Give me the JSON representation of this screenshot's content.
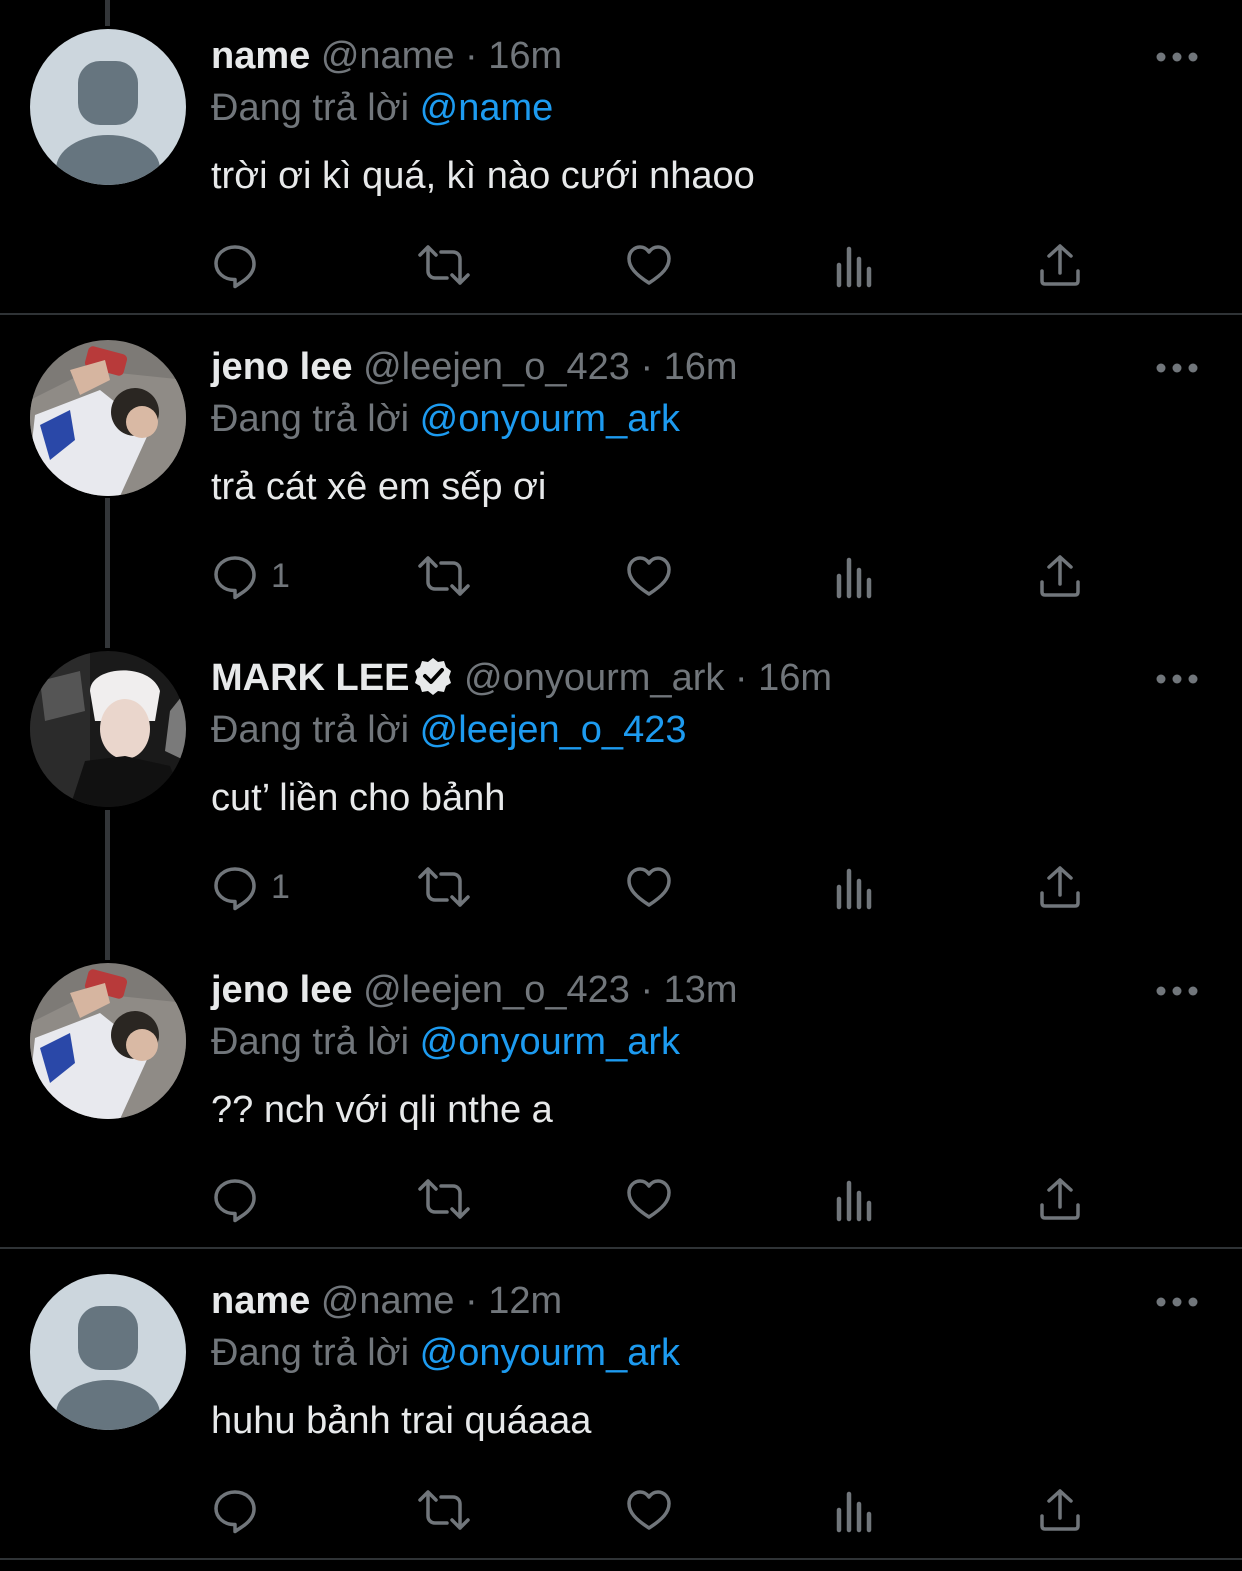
{
  "reply_prefix": "Đang trả lời",
  "tweets": [
    {
      "name": "name",
      "handle": "@name",
      "time": "16m",
      "replying_to": "@name",
      "text": "trời ơi kì quá, kì nào cưới nhaoo",
      "reply_count": "",
      "avatar": "default-avatar",
      "verified": false
    },
    {
      "name": "jeno lee",
      "handle": "@leejen_o_423",
      "time": "16m",
      "replying_to": "@onyourm_ark",
      "text": "trả cát xê em sếp ơi",
      "reply_count": "1",
      "avatar": "photo-avatar",
      "verified": false
    },
    {
      "name": "MARK LEE",
      "handle": "@onyourm_ark",
      "time": "16m",
      "replying_to": "@leejen_o_423",
      "text": "cut’ liền cho bảnh",
      "reply_count": "1",
      "avatar": "photo-avatar",
      "verified": true
    },
    {
      "name": "jeno lee",
      "handle": "@leejen_o_423",
      "time": "13m",
      "replying_to": "@onyourm_ark",
      "text": "?? nch với qli nthe a",
      "reply_count": "",
      "avatar": "photo-avatar",
      "verified": false
    },
    {
      "name": "name",
      "handle": "@name",
      "time": "12m",
      "replying_to": "@onyourm_ark",
      "text": "huhu bảnh trai quáaaa",
      "reply_count": "",
      "avatar": "default-avatar",
      "verified": false
    }
  ],
  "icons": [
    "reply-icon",
    "retweet-icon",
    "like-icon",
    "views-icon",
    "share-icon",
    "more-icon",
    "verified-icon"
  ],
  "colors": {
    "background": "#000000",
    "text": "#e7e9ea",
    "muted": "#71767b",
    "accent": "#1d9bf0",
    "divider": "#2f3336"
  }
}
